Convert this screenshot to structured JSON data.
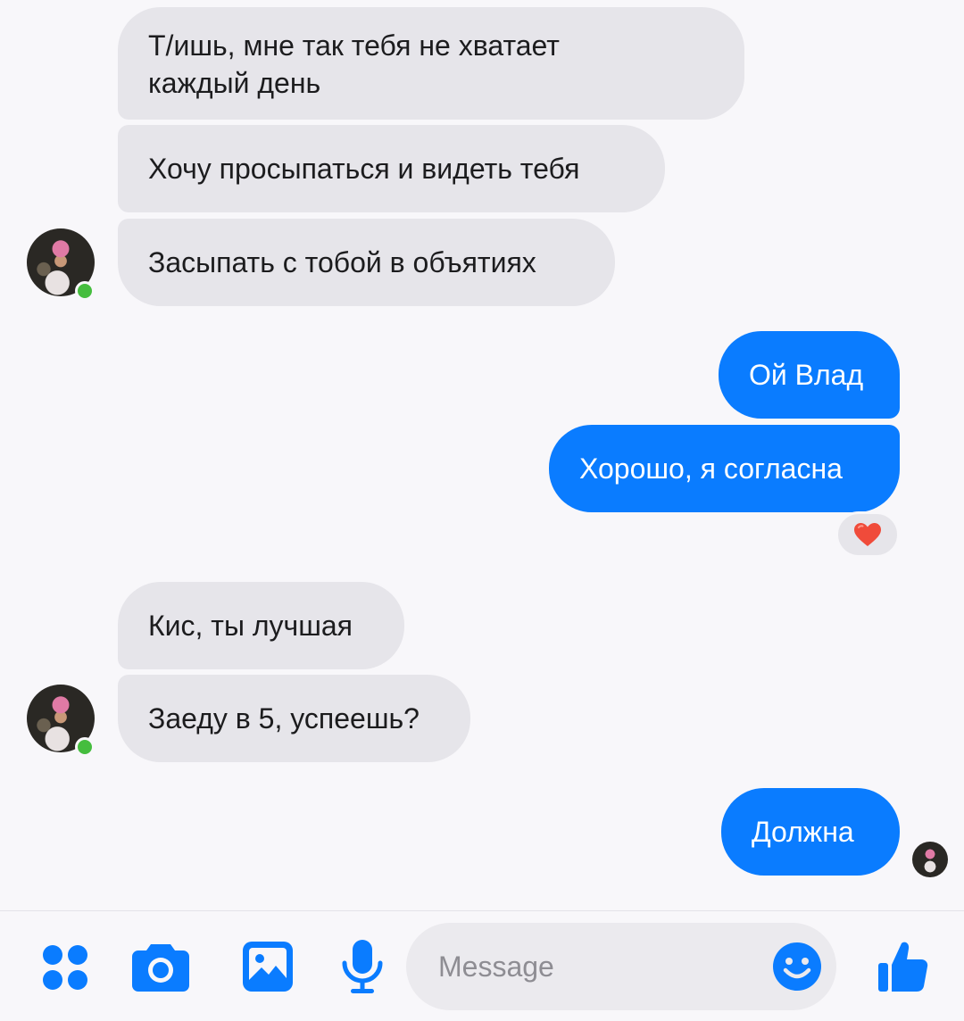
{
  "conversation": {
    "messages": [
      {
        "sender": "contact",
        "text_lines": [
          "Т/ишь, мне так тебя не хватает",
          "каждый день"
        ]
      },
      {
        "sender": "contact",
        "text": "Хочу просыпаться и видеть тебя"
      },
      {
        "sender": "contact",
        "text": "Засыпать с тобой в объятиях"
      },
      {
        "sender": "me",
        "text": "Ой Влад"
      },
      {
        "sender": "me",
        "text": "Хорошо, я согласна",
        "reaction": "❤️"
      },
      {
        "sender": "contact",
        "text": "Кис, ты лучшая"
      },
      {
        "sender": "contact",
        "text": "Заеду в 5, успеешь?"
      },
      {
        "sender": "me",
        "text": "Должна"
      }
    ]
  },
  "composer": {
    "placeholder": "Message",
    "icons": [
      "apps-grid-icon",
      "camera-icon",
      "gallery-icon",
      "microphone-icon",
      "emoji-icon",
      "thumbs-up-icon"
    ]
  },
  "colors": {
    "background": "#f8f7fa",
    "incoming_bubble": "#e6e5ea",
    "outgoing_bubble": "#0a7cff",
    "accent": "#0a7cff",
    "online": "#45bd3e"
  }
}
